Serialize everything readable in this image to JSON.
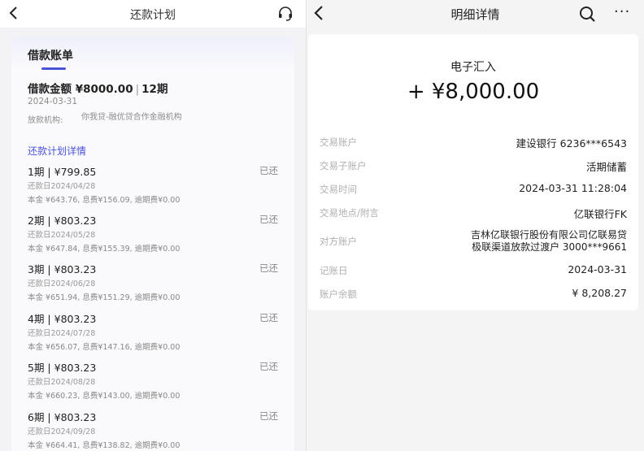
{
  "left": {
    "nav": {
      "title": "还款计划"
    },
    "card": {
      "tab": "借款账单",
      "amount_label": "借款金额 ¥8000.00",
      "amount_sep": "|",
      "term": "12期",
      "date": "2024-03-31",
      "lender_label": "放款机构:",
      "lender_value": "你我贷-融优贷合作金融机构",
      "plan_title": "还款计划详情",
      "installments": [
        {
          "title": "1期 | ¥799.85",
          "status": "已还",
          "due": "还款日2024/04/28",
          "breakdown": "本金 ¥643.76, 息费¥156.09, 逾期费¥0.00"
        },
        {
          "title": "2期 | ¥803.23",
          "status": "已还",
          "due": "还款日2024/05/28",
          "breakdown": "本金 ¥647.84, 息费¥155.39, 逾期费¥0.00"
        },
        {
          "title": "3期 | ¥803.23",
          "status": "已还",
          "due": "还款日2024/06/28",
          "breakdown": "本金 ¥651.94, 息费¥151.29, 逾期费¥0.00"
        },
        {
          "title": "4期 | ¥803.23",
          "status": "已还",
          "due": "还款日2024/07/28",
          "breakdown": "本金 ¥656.07, 息费¥147.16, 逾期费¥0.00"
        },
        {
          "title": "5期 | ¥803.23",
          "status": "已还",
          "due": "还款日2024/08/28",
          "breakdown": "本金 ¥660.23, 息费¥143.00, 逾期费¥0.00"
        },
        {
          "title": "6期 | ¥803.23",
          "status": "已还",
          "due": "还款日2024/09/28",
          "breakdown": "本金 ¥664.41, 息费¥138.82, 逾期费¥0.00"
        }
      ]
    }
  },
  "right": {
    "nav": {
      "title": "明细详情",
      "more": "···"
    },
    "tx_type": "电子汇入",
    "tx_amount": "+ ¥8,000.00",
    "rows": [
      {
        "label": "交易账户",
        "value": "建设银行 6236***6543"
      },
      {
        "label": "交易子账户",
        "value": "活期储蓄"
      },
      {
        "label": "交易时间",
        "value": "2024-03-31 11:28:04"
      },
      {
        "label": "交易地点/附言",
        "value": "亿联银行FK"
      },
      {
        "label": "对方账户",
        "value": "吉林亿联银行股份有限公司亿联易贷",
        "value2": "极联渠道放款过渡户 3000***9661"
      },
      {
        "label": "记账日",
        "value": "2024-03-31"
      },
      {
        "label": "账户余额",
        "value": "¥ 8,208.27"
      }
    ]
  },
  "colors": {
    "accent": "#4a52d8",
    "muted": "#8c8c8c",
    "label": "#b0b0b0"
  },
  "icons": [
    "back-arrow-icon",
    "headset-icon",
    "search-icon",
    "more-icon"
  ]
}
